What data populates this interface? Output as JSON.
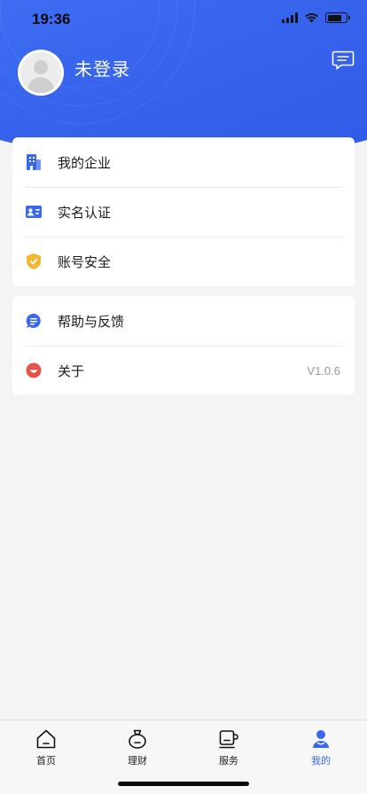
{
  "status_bar": {
    "time": "19:36"
  },
  "colors": {
    "header_gradient_start": "#3f6ef2",
    "header_gradient_end": "#2f5ae6",
    "accent": "#3a68ec",
    "shield": "#f2b630",
    "about_icon": "#e5534b",
    "background": "#f4f4f5"
  },
  "profile": {
    "name": "未登录",
    "avatar_icon": "default-avatar",
    "message_icon": "message-icon"
  },
  "menu": {
    "group_1": [
      {
        "label": "我的企业",
        "icon": "building-icon"
      },
      {
        "label": "实名认证",
        "icon": "id-card-icon"
      },
      {
        "label": "账号安全",
        "icon": "shield-icon"
      }
    ],
    "group_2": [
      {
        "label": "帮助与反馈",
        "icon": "chat-bubble-icon"
      },
      {
        "label": "关于",
        "icon": "smile-icon",
        "value": "V1.0.6"
      }
    ]
  },
  "tab_bar": {
    "active": "我的",
    "items": [
      {
        "label": "首页",
        "icon": "home-icon"
      },
      {
        "label": "理财",
        "icon": "money-bag-icon"
      },
      {
        "label": "服务",
        "icon": "cup-icon"
      },
      {
        "label": "我的",
        "icon": "user-icon"
      }
    ]
  }
}
